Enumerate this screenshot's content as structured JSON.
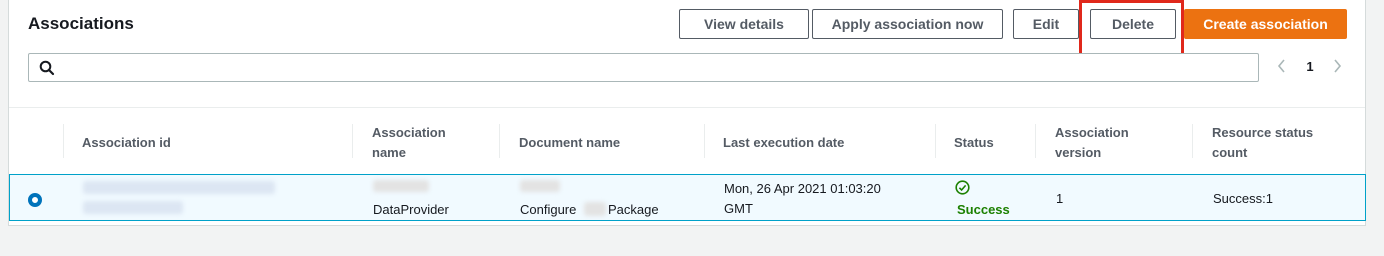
{
  "panel": {
    "title": "Associations"
  },
  "toolbar": {
    "view_details": "View details",
    "apply_now": "Apply association now",
    "edit": "Edit",
    "delete": "Delete",
    "create": "Create association"
  },
  "search": {
    "placeholder": ""
  },
  "pagination": {
    "prev": "‹",
    "current_page": "1",
    "next": "›"
  },
  "table": {
    "columns": [
      "Association id",
      "Association name",
      "Document name",
      "Last execution date",
      "Status",
      "Association version",
      "Resource status count"
    ],
    "rows": [
      {
        "selected": true,
        "association_name": "DataProvider",
        "document_name_prefix": "Configure",
        "document_name_suffix": "Package",
        "last_execution_line1": "Mon, 26 Apr 2021 01:03:20",
        "last_execution_line2": "GMT",
        "status": "Success",
        "version": "1",
        "resource_status_count": "Success:1"
      }
    ]
  },
  "colors": {
    "primary": "#ec7211",
    "highlight": "#e0281b",
    "success": "#1d8102",
    "selected_border": "#00a1c9",
    "radio": "#0073bb"
  }
}
